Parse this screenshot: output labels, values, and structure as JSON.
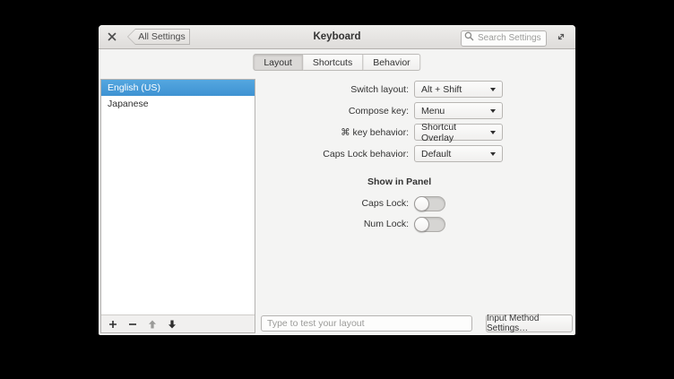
{
  "titlebar": {
    "title": "Keyboard",
    "back_button_label": "All Settings",
    "search_placeholder": "Search Settings"
  },
  "tabs": [
    {
      "label": "Layout",
      "active": true
    },
    {
      "label": "Shortcuts",
      "active": false
    },
    {
      "label": "Behavior",
      "active": false
    }
  ],
  "layout_list": {
    "items": [
      {
        "label": "English (US)",
        "selected": true
      },
      {
        "label": "Japanese",
        "selected": false
      }
    ],
    "toolbar": [
      "add",
      "remove",
      "move-up",
      "move-down"
    ]
  },
  "form": {
    "rows": [
      {
        "label": "Switch layout:",
        "value": "Alt + Shift"
      },
      {
        "label": "Compose key:",
        "value": "Menu"
      },
      {
        "label": "⌘ key behavior:",
        "value": "Shortcut Overlay"
      },
      {
        "label": "Caps Lock behavior:",
        "value": "Default"
      }
    ]
  },
  "panel_section": {
    "heading": "Show in Panel",
    "toggles": [
      {
        "label": "Caps Lock:",
        "on": false
      },
      {
        "label": "Num Lock:",
        "on": false
      }
    ]
  },
  "footer": {
    "test_input_placeholder": "Type to test your layout",
    "input_method_button": "Input Method Settings…"
  },
  "colors": {
    "selection_blue": "#459bda",
    "headerbar_top": "#efeeec",
    "headerbar_bottom": "#dedcda",
    "window_bg": "#f4f4f3"
  }
}
